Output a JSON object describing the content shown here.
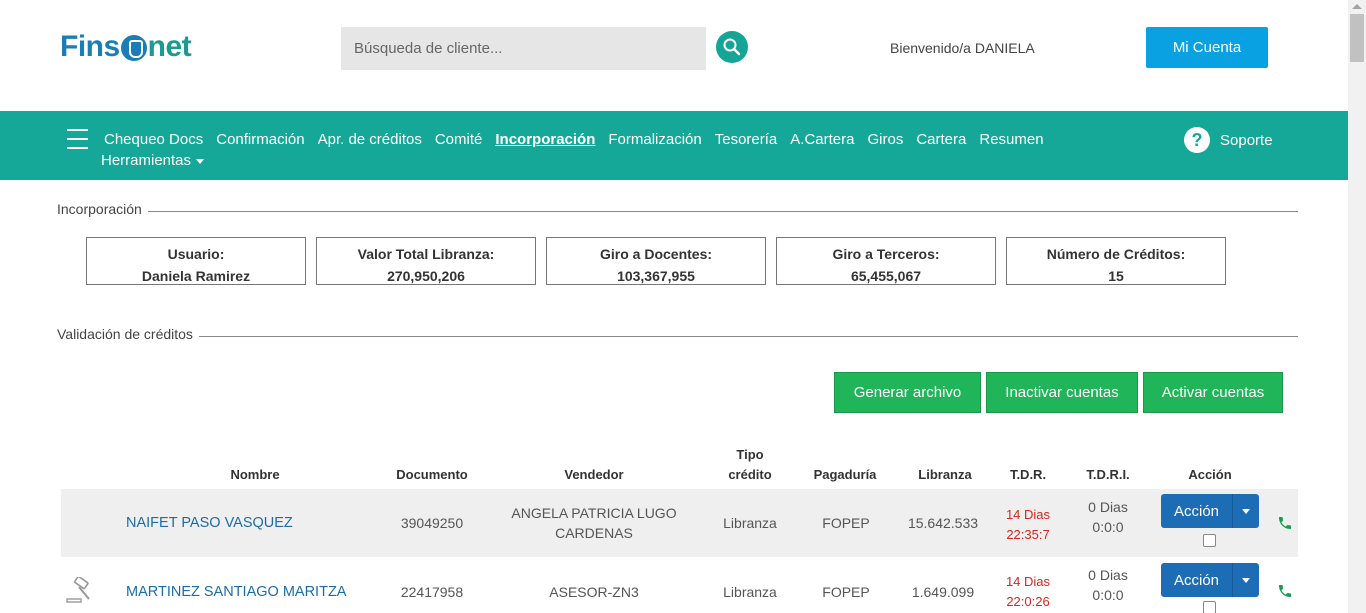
{
  "header": {
    "logo_left": "Fins",
    "logo_right": "net",
    "search_placeholder": "Búsqueda de cliente...",
    "welcome": "Bienvenido/a DANIELA",
    "account_button": "Mi Cuenta"
  },
  "nav": {
    "items": [
      {
        "label": "Chequeo Docs"
      },
      {
        "label": "Confirmación"
      },
      {
        "label": "Apr. de créditos"
      },
      {
        "label": "Comité"
      },
      {
        "label": "Incorporación",
        "active": true
      },
      {
        "label": "Formalización"
      },
      {
        "label": "Tesorería"
      },
      {
        "label": "A.Cartera"
      },
      {
        "label": "Giros"
      },
      {
        "label": "Cartera"
      },
      {
        "label": "Resumen"
      }
    ],
    "tools": "Herramientas",
    "help_icon": "?",
    "help": "Soporte"
  },
  "section1": {
    "title": "Incorporación"
  },
  "stats": [
    {
      "label": "Usuario:",
      "value": "Daniela Ramirez"
    },
    {
      "label": "Valor Total Libranza:",
      "value": "270,950,206"
    },
    {
      "label": "Giro a Docentes:",
      "value": "103,367,955"
    },
    {
      "label": "Giro a Terceros:",
      "value": "65,455,067"
    },
    {
      "label": "Número de Créditos:",
      "value": "15"
    }
  ],
  "section2": {
    "title": "Validación de créditos"
  },
  "buttons": {
    "generate": "Generar archivo",
    "deactivate": "Inactivar cuentas",
    "activate": "Activar cuentas"
  },
  "table": {
    "headers": {
      "nombre": "Nombre",
      "documento": "Documento",
      "vendedor": "Vendedor",
      "tipo1": "Tipo",
      "tipo2": "crédito",
      "pagaduria": "Pagaduría",
      "libranza": "Libranza",
      "tdr": "T.D.R.",
      "tdri": "T.D.R.I.",
      "accion": "Acción"
    },
    "rows": [
      {
        "nombre": "NAIFET PASO VASQUEZ",
        "documento": "39049250",
        "vendedor1": "ANGELA PATRICIA LUGO",
        "vendedor2": "CARDENAS",
        "tipo": "Libranza",
        "pagaduria": "FOPEP",
        "libranza": "15.642.533",
        "tdr1": "14 Dias",
        "tdr2": "22:35:7",
        "tdri1": "0 Dias",
        "tdri2": "0:0:0",
        "accion": "Acción"
      },
      {
        "nombre": "MARTINEZ SANTIAGO MARITZA",
        "documento": "22417958",
        "vendedor1": "ASESOR-ZN3",
        "vendedor2": "",
        "tipo": "Libranza",
        "pagaduria": "FOPEP",
        "libranza": "1.649.099",
        "tdr1": "14 Dias",
        "tdr2": "22:0:26",
        "tdri1": "0 Dias",
        "tdri2": "0:0:0",
        "accion": "Acción"
      }
    ]
  },
  "icons": {
    "search": "search-icon",
    "menu": "hamburger-menu-icon",
    "help": "question-circle-icon",
    "phone": "phone-icon",
    "gavel": "gavel-icon"
  },
  "colors": {
    "brand_blue": "#1a7db6",
    "nav_teal": "#15a898",
    "account_blue": "#0aa1e3",
    "green_button": "#20b558",
    "action_blue": "#1d6db6",
    "alert_red": "#d9251c"
  }
}
